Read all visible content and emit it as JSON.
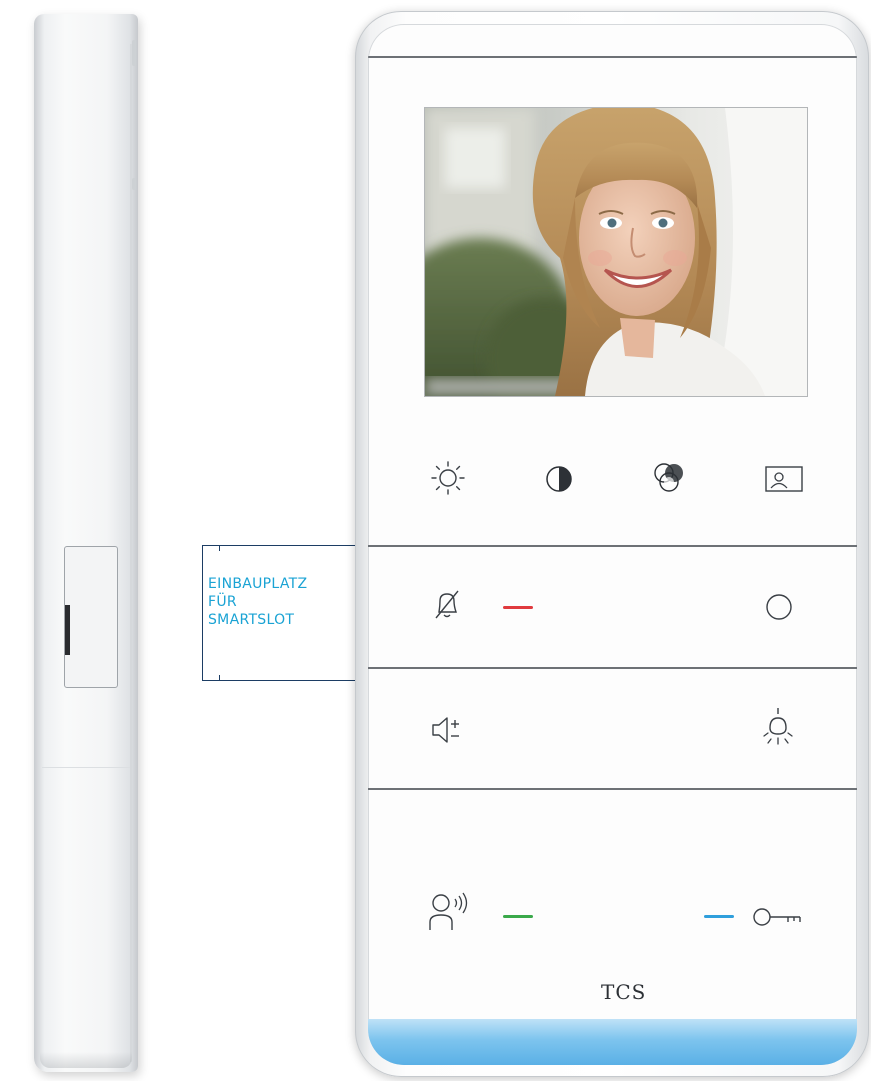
{
  "callout": {
    "lines": [
      "EINBAUPLATZ",
      "FÜR",
      "SMARTSLOT"
    ],
    "text_color": "#1aa3d4",
    "bracket_color": "#1c3d64"
  },
  "device": {
    "brand": "TCS",
    "screen_content": "woman-smiling-photo",
    "display_controls": [
      "brightness-icon",
      "contrast-icon",
      "color-saturation-icon",
      "image-mode-icon"
    ],
    "buttons": [
      {
        "icon": "bell-muted-icon",
        "led": "red"
      },
      {
        "icon": "circle-button-icon"
      },
      {
        "icon": "volume-icon"
      },
      {
        "icon": "light-icon"
      },
      {
        "icon": "speak-icon",
        "led": "green"
      },
      {
        "icon": "key-icon",
        "led": "blue"
      }
    ],
    "colors": {
      "led_red": "#e03a3e",
      "led_green": "#3aa94a",
      "led_blue": "#2f9fdc",
      "led_strip": "#5ab0e6"
    }
  }
}
